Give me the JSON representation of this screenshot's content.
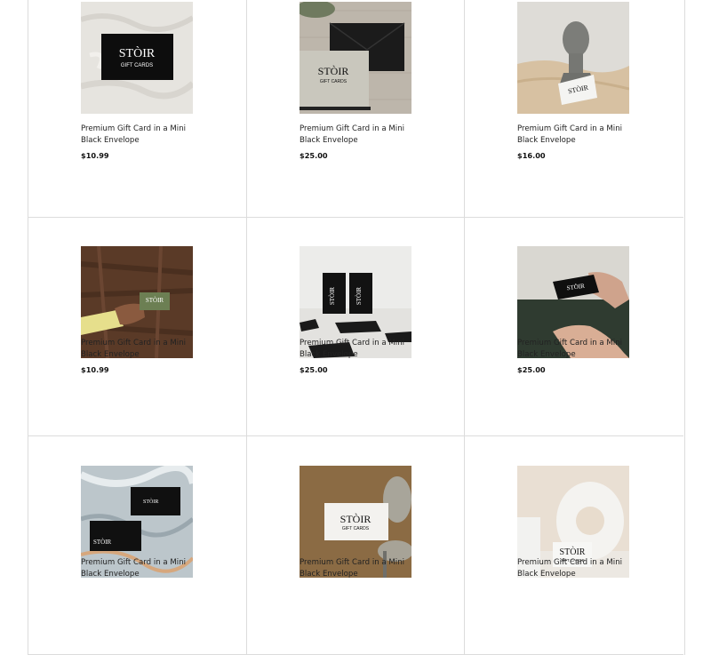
{
  "products": [
    {
      "title": "Premium Gift Card in a Mini Black Envelope",
      "price": "$10.99",
      "image": "card-on-textured-white"
    },
    {
      "title": "Premium Gift Card in a Mini Black Envelope",
      "price": "$25.00",
      "image": "card-with-black-envelope"
    },
    {
      "title": "Premium Gift Card in a Mini Black Envelope",
      "price": "$16.00",
      "image": "card-with-stone-bust"
    },
    {
      "title": "Premium Gift Card in a Mini Black Envelope",
      "price": "$10.99",
      "image": "green-card-held-on-wood"
    },
    {
      "title": "Premium Gift Card in a Mini Black Envelope",
      "price": "$25.00",
      "image": "two-black-cards-standing"
    },
    {
      "title": "Premium Gift Card in a Mini Black Envelope",
      "price": "$25.00",
      "image": "black-card-held-in-hands"
    },
    {
      "title": "Premium Gift Card in a Mini Black Envelope",
      "price": "",
      "image": "cards-on-marble"
    },
    {
      "title": "Premium Gift Card in a Mini Black Envelope",
      "price": "",
      "image": "white-card-with-chair"
    },
    {
      "title": "Premium Gift Card in a Mini Black Envelope",
      "price": "",
      "image": "card-with-ring-vase"
    }
  ],
  "brand": {
    "name": "STÒIR",
    "sub": "GIFT CARDS"
  },
  "colors": {
    "border": "#dcdcdc",
    "text": "#222222"
  }
}
